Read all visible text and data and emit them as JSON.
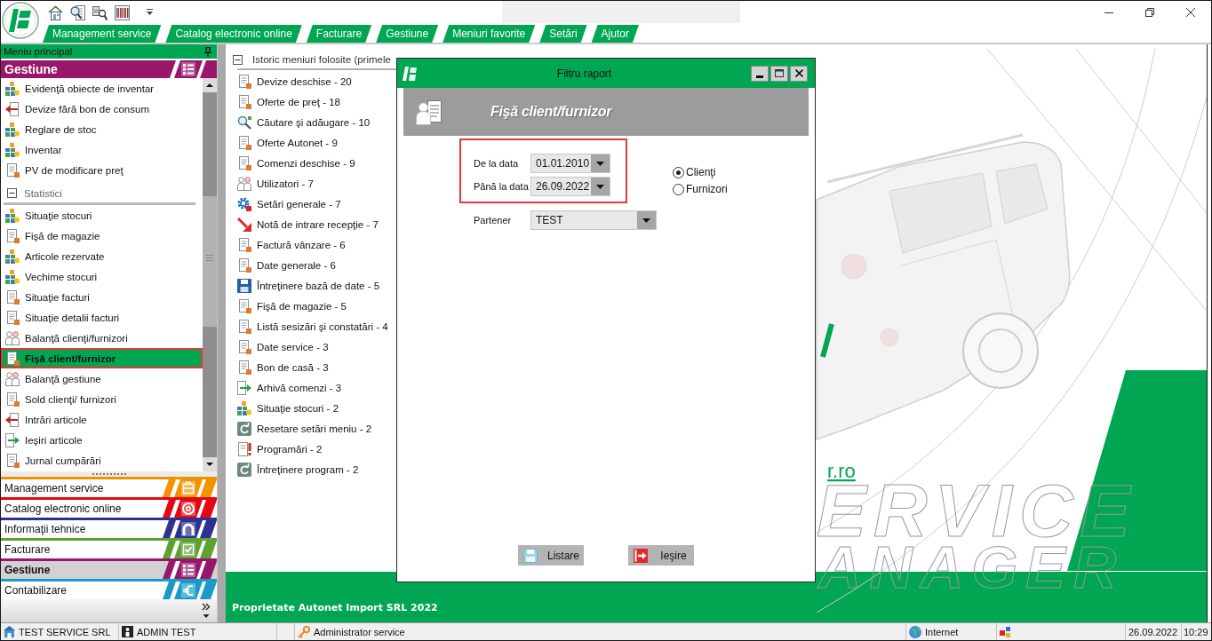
{
  "menu_bar": {
    "tabs": [
      "Management service",
      "Catalog electronic online",
      "Facturare",
      "Gestiune",
      "Meniuri favorite",
      "Setări",
      "Ajutor"
    ]
  },
  "sidebar": {
    "title": "Meniu principal",
    "section": "Gestiune",
    "items": [
      {
        "kind": "item",
        "label": "Evidenţă obiecte de inventar",
        "selected": false
      },
      {
        "kind": "item",
        "label": "Devize fără bon de consum",
        "selected": false
      },
      {
        "kind": "item",
        "label": "Reglare de stoc",
        "selected": false
      },
      {
        "kind": "item",
        "label": "Inventar",
        "selected": false
      },
      {
        "kind": "item",
        "label": "PV de modificare preţ",
        "selected": false
      },
      {
        "kind": "group",
        "label": "Statistici",
        "expanded": true,
        "children": [
          {
            "label": "Situaţie stocuri",
            "selected": false
          },
          {
            "label": "Fişă de magazie",
            "selected": false
          },
          {
            "label": "Articole rezervate",
            "selected": false
          },
          {
            "label": "Vechime stocuri",
            "selected": false
          },
          {
            "label": "Situaţie facturi",
            "selected": false
          },
          {
            "label": "Situaţie detalii facturi",
            "selected": false
          },
          {
            "label": "Balanţă clienţi/furnizori",
            "selected": false
          },
          {
            "label": "Fişă client/furnizor",
            "selected": true
          },
          {
            "label": "Balanţă gestiune",
            "selected": false
          },
          {
            "label": "Sold clienţi/ furnizori",
            "selected": false
          },
          {
            "label": "Intrări articole",
            "selected": false
          },
          {
            "label": "Ieşiri articole",
            "selected": false
          },
          {
            "label": "Jurnal cumpărări",
            "selected": false
          }
        ]
      }
    ]
  },
  "nav_buttons": [
    {
      "label": "Management service",
      "color": "#f39200",
      "selected": false
    },
    {
      "label": "Catalog electronic online",
      "color": "#e30613",
      "selected": false
    },
    {
      "label": "Informaţii tehnice",
      "color": "#2e3192",
      "selected": false
    },
    {
      "label": "Facturare",
      "color": "#5da130",
      "selected": false
    },
    {
      "label": "Gestiune",
      "color": "#98176b",
      "selected": true
    },
    {
      "label": "Contabilizare",
      "color": "#1a9bc7",
      "selected": false
    }
  ],
  "history": {
    "title": "Istoric meniuri folosite (primele",
    "expanded": true,
    "items": [
      "Devize deschise - 20",
      "Oferte de preţ - 18",
      "Căutare şi adăugare - 10",
      "Oferte Autonet - 9",
      "Comenzi deschise - 9",
      "Utilizatori - 7",
      "Setări generale - 7",
      "Notă de intrare recepţie - 7",
      "Factură vânzare - 6",
      "Date generale - 6",
      "Întreţinere bază de date - 5",
      "Fişă de magazie - 5",
      "Listă sesizări şi constatări - 4",
      "Date service - 3",
      "Bon de casă - 3",
      "Arhivă comenzi - 3",
      "Situaţie stocuri - 2",
      "Resetare setări meniu - 2",
      "Programări - 2",
      "Întreţinere program - 2"
    ]
  },
  "branding": {
    "link": "r.ro",
    "logo_lines": [
      "ERVICE",
      "ANAGER"
    ]
  },
  "footer": {
    "text": "Proprietate Autonet Import SRL 2022"
  },
  "dialog": {
    "title": "Filtru raport",
    "heading": "Fişă client/furnizor",
    "date_range": {
      "highlighted": true,
      "fields": [
        {
          "label": "De la data",
          "value": "01.01.2010"
        },
        {
          "label": "Până la data",
          "value": "26.09.2022"
        }
      ]
    },
    "options": [
      {
        "label": "Clienţi",
        "selected": true
      },
      {
        "label": "Furnizori",
        "selected": false
      }
    ],
    "partner": {
      "label": "Partener",
      "value": "TEST"
    },
    "buttons": [
      {
        "kind": "print",
        "label": "Listare"
      },
      {
        "kind": "exit",
        "label": "Ieşire"
      }
    ]
  },
  "status_bar": {
    "company": "TEST SERVICE SRL",
    "user": "ADMIN TEST",
    "role": "Administrator service",
    "connection": "Internet",
    "date": "26.09.2022",
    "time": "10:29"
  }
}
